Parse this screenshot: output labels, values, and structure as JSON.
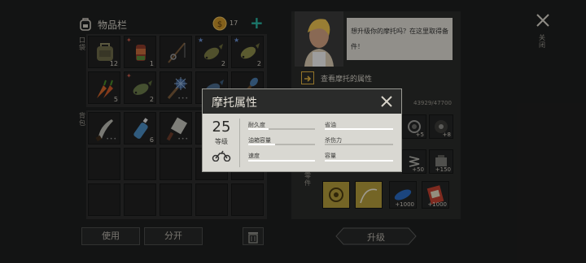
{
  "inventory": {
    "title": "物品栏",
    "coin_count": "17",
    "add_label": "+",
    "pocket_label": "口袋",
    "backpack_label": "背包",
    "pocket_items": [
      {
        "icon": "backpack-icon",
        "count": "12",
        "star": ""
      },
      {
        "icon": "meat-can-icon",
        "count": "1",
        "star": "✦"
      },
      {
        "icon": "fishing-rod-icon",
        "count": "",
        "star": ""
      },
      {
        "icon": "fish-icon",
        "count": "2",
        "star": "★"
      },
      {
        "icon": "fish-icon",
        "count": "2",
        "star": "★"
      },
      {
        "icon": "carrot-icon",
        "count": "5",
        "star": ""
      },
      {
        "icon": "fish-icon",
        "count": "2",
        "star": "✦"
      },
      {
        "icon": "spiked-mace-icon",
        "count": "",
        "star": ""
      },
      {
        "icon": "fish-icon",
        "count": "",
        "star": ""
      },
      {
        "icon": "paddle-icon",
        "count": "",
        "star": ""
      }
    ],
    "backpack_items": [
      {
        "icon": "machete-icon",
        "count": "",
        "star": ""
      },
      {
        "icon": "water-bottle-icon",
        "count": "6",
        "star": ""
      },
      {
        "icon": "cleaver-icon",
        "count": "",
        "star": ""
      }
    ],
    "use_button": "使用",
    "split_button": "分开"
  },
  "npc": {
    "speech": "想升级你的摩托吗？在这里取得备件！"
  },
  "close_side_label": "关闭",
  "motorcycle": {
    "view_attributes": "查看摩托的属性",
    "progress": "43929/47700",
    "parts_label": "零件",
    "part_counts": [
      "+5",
      "+8",
      "+50",
      "+150",
      "+1000",
      "+1000"
    ],
    "upgrade_button": "升级"
  },
  "modal": {
    "title": "摩托属性",
    "level_value": "25",
    "level_label": "等级",
    "stats": [
      {
        "label": "耐久度",
        "fill": 0.3
      },
      {
        "label": "省油",
        "fill": 1.0
      },
      {
        "label": "油箱容量",
        "fill": 0.4
      },
      {
        "label": "杀伤力",
        "fill": 0.0
      },
      {
        "label": "速度",
        "fill": 1.0
      },
      {
        "label": "容量",
        "fill": 1.0
      }
    ]
  },
  "colors": {
    "accent": "#2ab3a2",
    "coin": "#c7922a",
    "modal_bg": "#d9d8d2"
  }
}
